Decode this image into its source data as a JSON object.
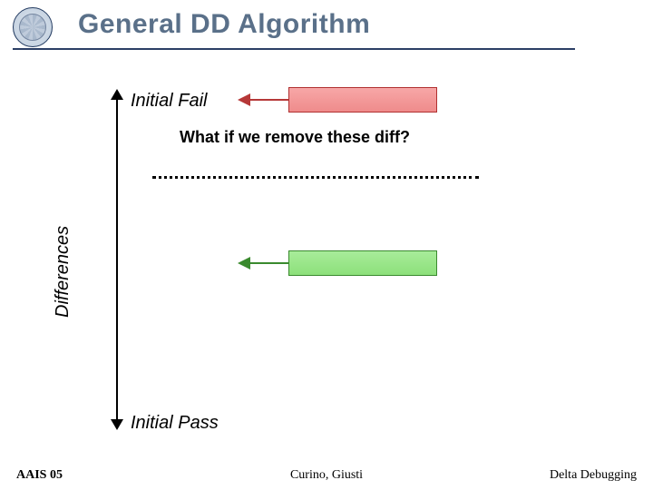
{
  "header": {
    "title": "General DD Algorithm"
  },
  "diagram": {
    "axis_label": "Differences",
    "top_label": "Initial Fail",
    "bottom_label": "Initial Pass",
    "question": "What if we remove these diff?",
    "blocks": {
      "fail": {
        "color": "#ef8b8b",
        "name": "fail-state-block"
      },
      "pass": {
        "color": "#8ce07a",
        "name": "pass-state-block"
      }
    }
  },
  "footer": {
    "left": "AAIS 05",
    "center": "Curino, Giusti",
    "right": "Delta Debugging"
  }
}
